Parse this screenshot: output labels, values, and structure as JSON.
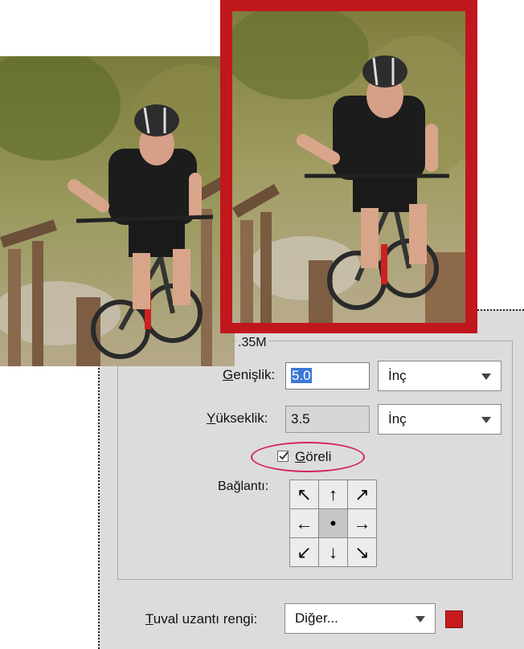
{
  "dialog": {
    "group_title_fragment": ".35M",
    "width": {
      "label_prefix": "G",
      "label_rest": "enişlik:",
      "value": "5.0",
      "unit": "İnç"
    },
    "height": {
      "label_prefix": "Y",
      "label_rest": "ükseklik:",
      "value": "3.5",
      "unit": "İnç"
    },
    "relative": {
      "label_prefix": "G",
      "label_rest": "öreli",
      "checked": true
    },
    "anchor_label": "Bağlantı:",
    "anchor_arrows": [
      "↖",
      "↑",
      "↗",
      "←",
      "•",
      "→",
      "↙",
      "↓",
      "↘"
    ],
    "canvas_color": {
      "label_prefix": "T",
      "label_rest": "uval uzantı rengi:",
      "value": "Diğer...",
      "swatch_color": "#c81c1c"
    }
  },
  "accent": {
    "frame_color": "#c0171c",
    "highlight_ellipse": "#d4245a",
    "selection": "#3d78d8"
  }
}
